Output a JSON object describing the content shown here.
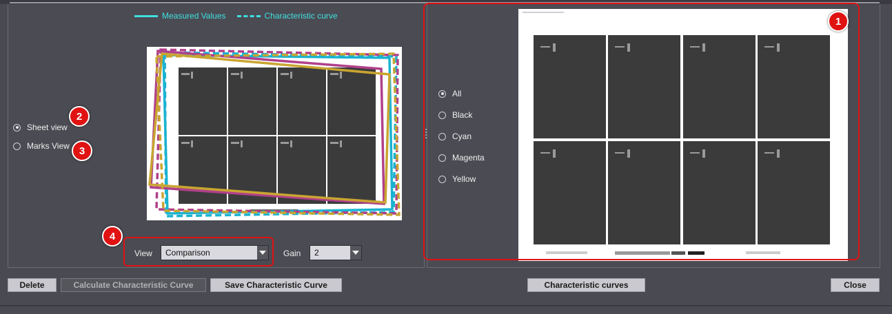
{
  "legend": {
    "measured": "Measured Values",
    "characteristic": "Characteristic curve"
  },
  "view_mode": {
    "options": [
      {
        "label": "Sheet view",
        "checked": true
      },
      {
        "label": "Marks View",
        "checked": false
      }
    ]
  },
  "controls": {
    "view_label": "View",
    "view_value": "Comparison",
    "gain_label": "Gain",
    "gain_value": "2"
  },
  "colors_filter": {
    "options": [
      {
        "label": "All",
        "checked": true
      },
      {
        "label": "Black",
        "checked": false
      },
      {
        "label": "Cyan",
        "checked": false
      },
      {
        "label": "Magenta",
        "checked": false
      },
      {
        "label": "Yellow",
        "checked": false
      }
    ]
  },
  "badges": [
    "1",
    "2",
    "3",
    "4"
  ],
  "buttons": {
    "delete": "Delete",
    "calculate": "Calculate Characteristic Curve",
    "save": "Save Characteristic Curve",
    "curves": "Characteristic curves",
    "close": "Close"
  },
  "colors": {
    "accent_cyan": "#3fe0e0",
    "highlight_red": "#e01212",
    "outline_cyan": "#1ab2d0",
    "outline_magenta": "#b0408a",
    "outline_yellow": "#c9a531",
    "background": "#4a4a52"
  }
}
